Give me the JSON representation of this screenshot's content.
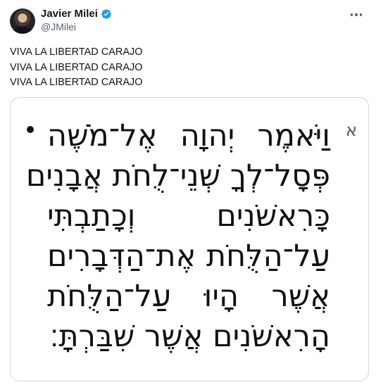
{
  "author": {
    "name": "Javier Milei",
    "handle": "@JMilei",
    "verified_color": "#1d9bf0"
  },
  "tweet": {
    "lines": [
      "VIVA LA LIBERTAD CARAJO",
      "VIVA LA LIBERTAD CARAJO",
      "VIVA LA LIBERTAD CARAJO"
    ]
  },
  "media": {
    "verse_number": "א",
    "hebrew_lines": [
      "וַיֹּאמֶר יְהוָה אֶל־מֹשֶׁה",
      "פְּסָל־לְךָ שְׁנֵי־לֻחֹת אֲבָנִים",
      "כָּרִאשֹׁנִים וְכָתַבְתִּי",
      "עַל־הַלֻּחֹת אֶת־הַדְּבָרִים",
      "אֲשֶׁר הָיוּ עַל־הַלֻּחֹת",
      "הָרִאשֹׁנִים אֲשֶׁר שִׁבַּרְתָּ׃"
    ]
  }
}
